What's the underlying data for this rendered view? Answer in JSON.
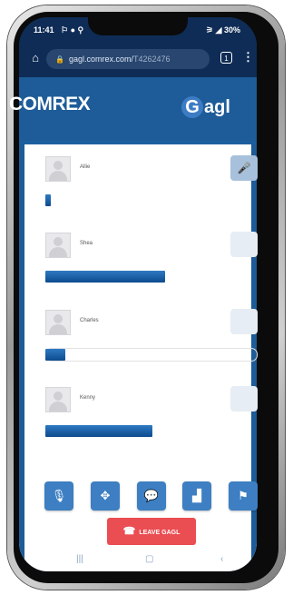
{
  "status_bar": {
    "time": "11:41",
    "left_icons": "⚐ ● ⚲",
    "right": "⚞ ◢ 30%"
  },
  "browser": {
    "url_host": "gagl.comrex.com/",
    "url_path": "T4262476",
    "tabs_count": "1"
  },
  "header": {
    "brand": "COMREX",
    "app": "agl"
  },
  "participants": [
    {
      "name": "Allie",
      "level": 0.03
    },
    {
      "name": "Shea",
      "level": 0.57
    },
    {
      "name": "Charles",
      "level": 0.09
    },
    {
      "name": "Kenny",
      "level": 0.51
    }
  ],
  "toolbar": {
    "buttons": [
      "mic-mute",
      "position",
      "chat",
      "signal-stats",
      "flag"
    ]
  },
  "leave_label": "LEAVE GAGL",
  "colors": {
    "accent": "#1d5c98",
    "meter": "#1a5ea6",
    "leave": "#ea4d52"
  }
}
